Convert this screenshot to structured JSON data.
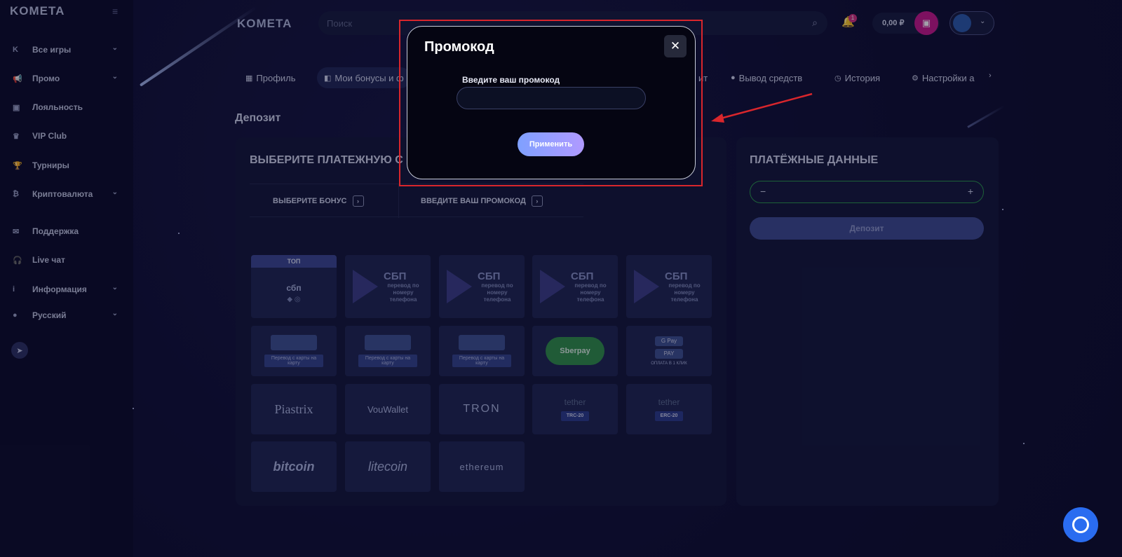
{
  "sidebar": {
    "logo": "KOMETA",
    "collapse_icon": "≡",
    "items": [
      {
        "label": "Все игры",
        "icon": "K",
        "chevron": "⌄"
      },
      {
        "label": "Промо",
        "icon": "📢",
        "chevron": "⌄"
      },
      {
        "label": "Лояльность",
        "icon": "▣",
        "chevron": ""
      },
      {
        "label": "VIP Club",
        "icon": "♛",
        "chevron": ""
      },
      {
        "label": "Турниры",
        "icon": "🏆",
        "chevron": ""
      },
      {
        "label": "Криптовалюта",
        "icon": "₿",
        "chevron": "⌄"
      },
      {
        "label": "Поддержка",
        "icon": "✉",
        "chevron": ""
      },
      {
        "label": "Live чат",
        "icon": "🎧",
        "chevron": ""
      },
      {
        "label": "Информация",
        "icon": "i",
        "chevron": "⌄"
      },
      {
        "label": "Русский",
        "icon": "●",
        "chevron": "⌄"
      }
    ],
    "telegram_icon": "➤"
  },
  "header": {
    "logo": "KOMETA",
    "search_placeholder": "Поиск",
    "notification_count": "1",
    "balance": "0,00 ₽"
  },
  "tabs": [
    {
      "label": "Профиль",
      "icon": "▦"
    },
    {
      "label": "Мои бонусы и ф",
      "icon": "◧"
    },
    {
      "label": "ит",
      "icon": ""
    },
    {
      "label": "Вывод средств",
      "icon": "●"
    },
    {
      "label": "История",
      "icon": "◷"
    },
    {
      "label": "Настройки а",
      "icon": "⚙"
    }
  ],
  "section_title": "Депозит",
  "payment_panel": {
    "title": "ВЫБЕРИТЕ ПЛАТЕЖНУЮ С",
    "option_bonus": "ВЫБЕРИТЕ БОНУС",
    "option_promo": "ВВЕДИТЕ ВАШ ПРОМОКОД",
    "top_badge": "ТОП",
    "sbp_small": "сбп",
    "sbp_title": "СБП",
    "sbp_sub": "перевод по номеру телефона",
    "card_caption": "Перевод с карты на карту",
    "sberpay": "Sberpay",
    "pay_gpay": "G Pay",
    "pay_apay": "PAY",
    "pay_caption": "ОПЛАТА В 1 КЛИК",
    "piastrix": "Piastrix",
    "vouwallet": "VouWallet",
    "tron": "TRON",
    "tether": "tether",
    "trc20": "TRC-20",
    "erc20": "ERC-20",
    "bitcoin": "bitcoin",
    "litecoin": "litecoin",
    "ethereum": "ethereum"
  },
  "payment_data": {
    "title": "ПЛАТЁЖНЫЕ ДАННЫЕ",
    "minus": "−",
    "plus": "+",
    "deposit_button": "Депозит"
  },
  "modal": {
    "title": "Промокод",
    "close": "✕",
    "label": "Введите ваш промокод",
    "input_value": "",
    "apply_button": "Применить"
  },
  "colors": {
    "background": "#0c0c2a",
    "accent_annotation": "#d9262c",
    "wallet": "#c5188a",
    "chat": "#2a6cf0"
  }
}
